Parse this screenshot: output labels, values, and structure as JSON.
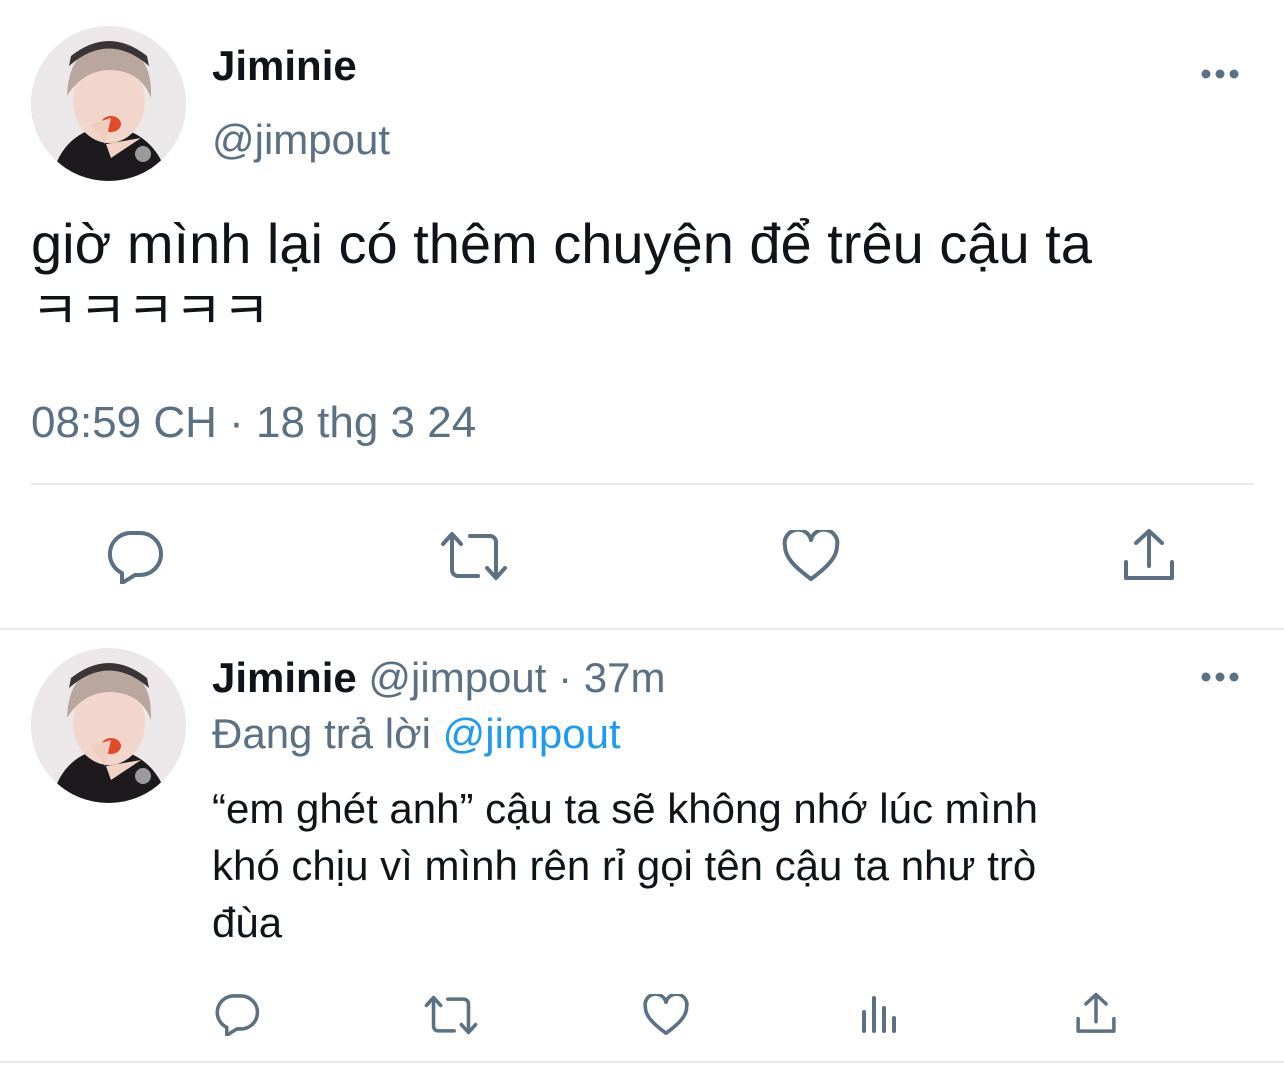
{
  "main_tweet": {
    "display_name": "Jiminie",
    "handle": "@jimpout",
    "text_line1": "giờ mình lại có thêm chuyện để trêu cậu ta",
    "text_line2": "ㅋㅋㅋㅋㅋ",
    "timestamp": "08:59 CH · 18 thg 3 24",
    "icons": {
      "reply": "reply-icon",
      "retweet": "retweet-icon",
      "like": "like-icon",
      "share": "share-icon"
    }
  },
  "reply_tweet": {
    "display_name": "Jiminie",
    "handle": "@jimpout",
    "separator": "·",
    "time_ago": "37m",
    "replying_prefix": "Đang trả lời",
    "replying_to": "@jimpout",
    "text_line1": "“em ghét anh” cậu ta sẽ không nhớ  lúc mình",
    "text_line2": "khó chịu vì mình rên rỉ gọi tên cậu ta như trò",
    "text_line3": "đùa",
    "icons": {
      "reply": "reply-icon",
      "retweet": "retweet-icon",
      "like": "like-icon",
      "views": "views-icon",
      "share": "share-icon"
    }
  },
  "colors": {
    "text": "#0f1419",
    "muted": "#5b7083",
    "link": "#1d9bf0",
    "divider": "#e6ecf0"
  }
}
